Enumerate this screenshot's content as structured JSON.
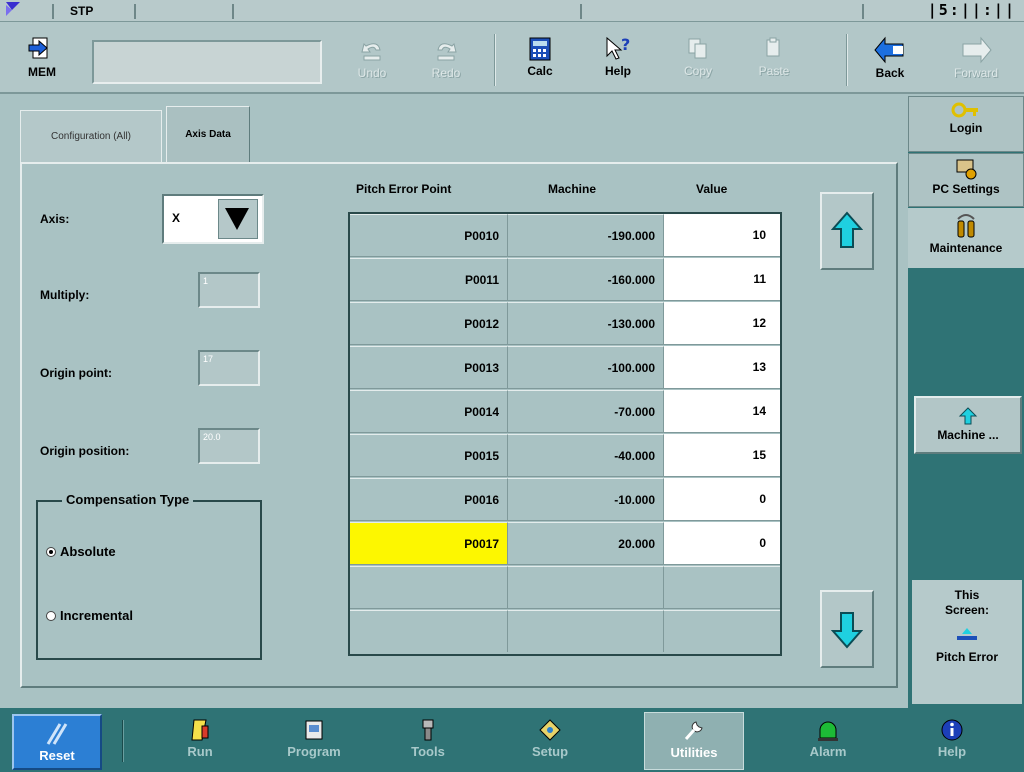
{
  "status": {
    "mode": "STP",
    "clock": "|5:||:||"
  },
  "toolbar": {
    "mem_label": "MEM",
    "undo_label": "Undo",
    "redo_label": "Redo",
    "calc_label": "Calc",
    "help_label": "Help",
    "copy_label": "Copy",
    "paste_label": "Paste",
    "back_label": "Back",
    "forward_label": "Forward",
    "mdi_value": ""
  },
  "right_panel": {
    "login_label": "Login",
    "pc_settings_label": "PC Settings",
    "maintenance_label": "Maintenance",
    "machine_label": "Machine ...",
    "this_screen_line1": "This",
    "this_screen_line2": "Screen:",
    "this_screen_name": "Pitch Error"
  },
  "tabs": [
    {
      "label": "Configuration (All)",
      "active": false
    },
    {
      "label": "Axis Data",
      "active": true
    }
  ],
  "form": {
    "axis_label": "Axis:",
    "axis_value": "X",
    "multiply_label": "Multiply:",
    "multiply_value": "1",
    "origin_point_label": "Origin point:",
    "origin_point_value": "17",
    "origin_position_label": "Origin position:",
    "origin_position_value": "20.0",
    "compensation_title": "Compensation Type",
    "absolute_label": "Absolute",
    "incremental_label": "Incremental",
    "compensation_selected": "Absolute"
  },
  "table": {
    "headers": [
      "Pitch Error Point",
      "Machine",
      "Value"
    ],
    "rows": [
      {
        "point": "P0010",
        "machine": "-190.000",
        "value": "10"
      },
      {
        "point": "P0011",
        "machine": "-160.000",
        "value": "11"
      },
      {
        "point": "P0012",
        "machine": "-130.000",
        "value": "12"
      },
      {
        "point": "P0013",
        "machine": "-100.000",
        "value": "13"
      },
      {
        "point": "P0014",
        "machine": "-70.000",
        "value": "14"
      },
      {
        "point": "P0015",
        "machine": "-40.000",
        "value": "15"
      },
      {
        "point": "P0016",
        "machine": "-10.000",
        "value": "0"
      },
      {
        "point": "P0017",
        "machine": "20.000",
        "value": "0",
        "selected": true
      },
      {
        "point": "",
        "machine": "",
        "value": ""
      },
      {
        "point": "",
        "machine": "",
        "value": ""
      }
    ]
  },
  "bottom_nav": {
    "reset_label": "Reset",
    "items": [
      {
        "label": "Run",
        "icon": "run-icon"
      },
      {
        "label": "Program",
        "icon": "program-icon"
      },
      {
        "label": "Tools",
        "icon": "tools-icon"
      },
      {
        "label": "Setup",
        "icon": "setup-icon"
      },
      {
        "label": "Utilities",
        "icon": "utilities-icon",
        "active": true
      },
      {
        "label": "Alarm",
        "icon": "alarm-icon"
      },
      {
        "label": "Help",
        "icon": "help-icon"
      }
    ]
  },
  "colors": {
    "background": "#a9c2c3",
    "panel_dark": "#2f7375",
    "selected_cell": "#fdf700",
    "reset_blue": "#2c7fd4",
    "arrow_cyan": "#1fd0e0"
  }
}
